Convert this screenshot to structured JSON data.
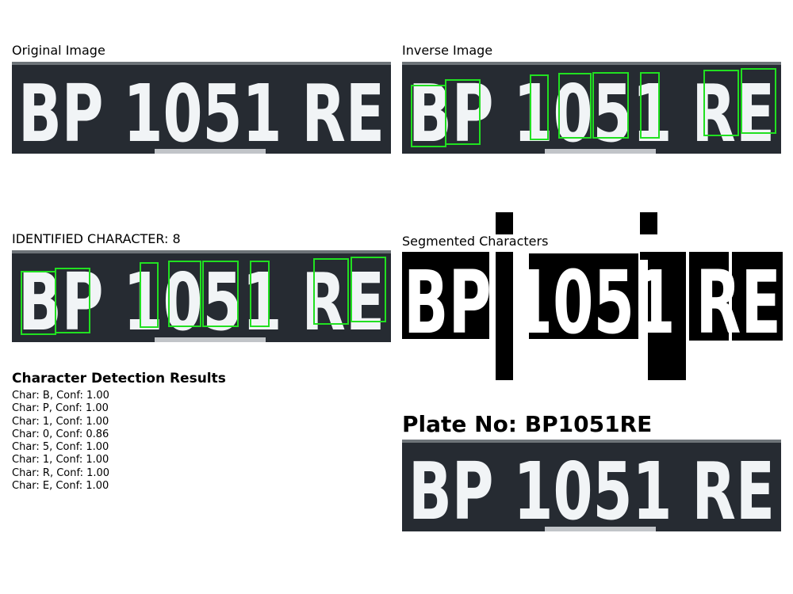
{
  "panels": {
    "original_title": "Original Image",
    "inverse_title": "Inverse Image",
    "identified_title": "IDENTIFIED CHARACTER: 8",
    "segmented_title": "Segmented Characters"
  },
  "plate_image": {
    "line1": "BP 1051 RE",
    "background_color": "#262b32",
    "text_color": "#f1f4f6",
    "box_color": "#21e021"
  },
  "results": {
    "heading": "Character Detection Results",
    "rows": [
      "Char: B, Conf: 1.00",
      "Char: P, Conf: 1.00",
      "Char: 1, Conf: 1.00",
      "Char: 0, Conf: 0.86",
      "Char: 5, Conf: 1.00",
      "Char: 1, Conf: 1.00",
      "Char: R, Conf: 1.00",
      "Char: E, Conf: 1.00"
    ]
  },
  "plate_number": "Plate No: BP1051RE"
}
